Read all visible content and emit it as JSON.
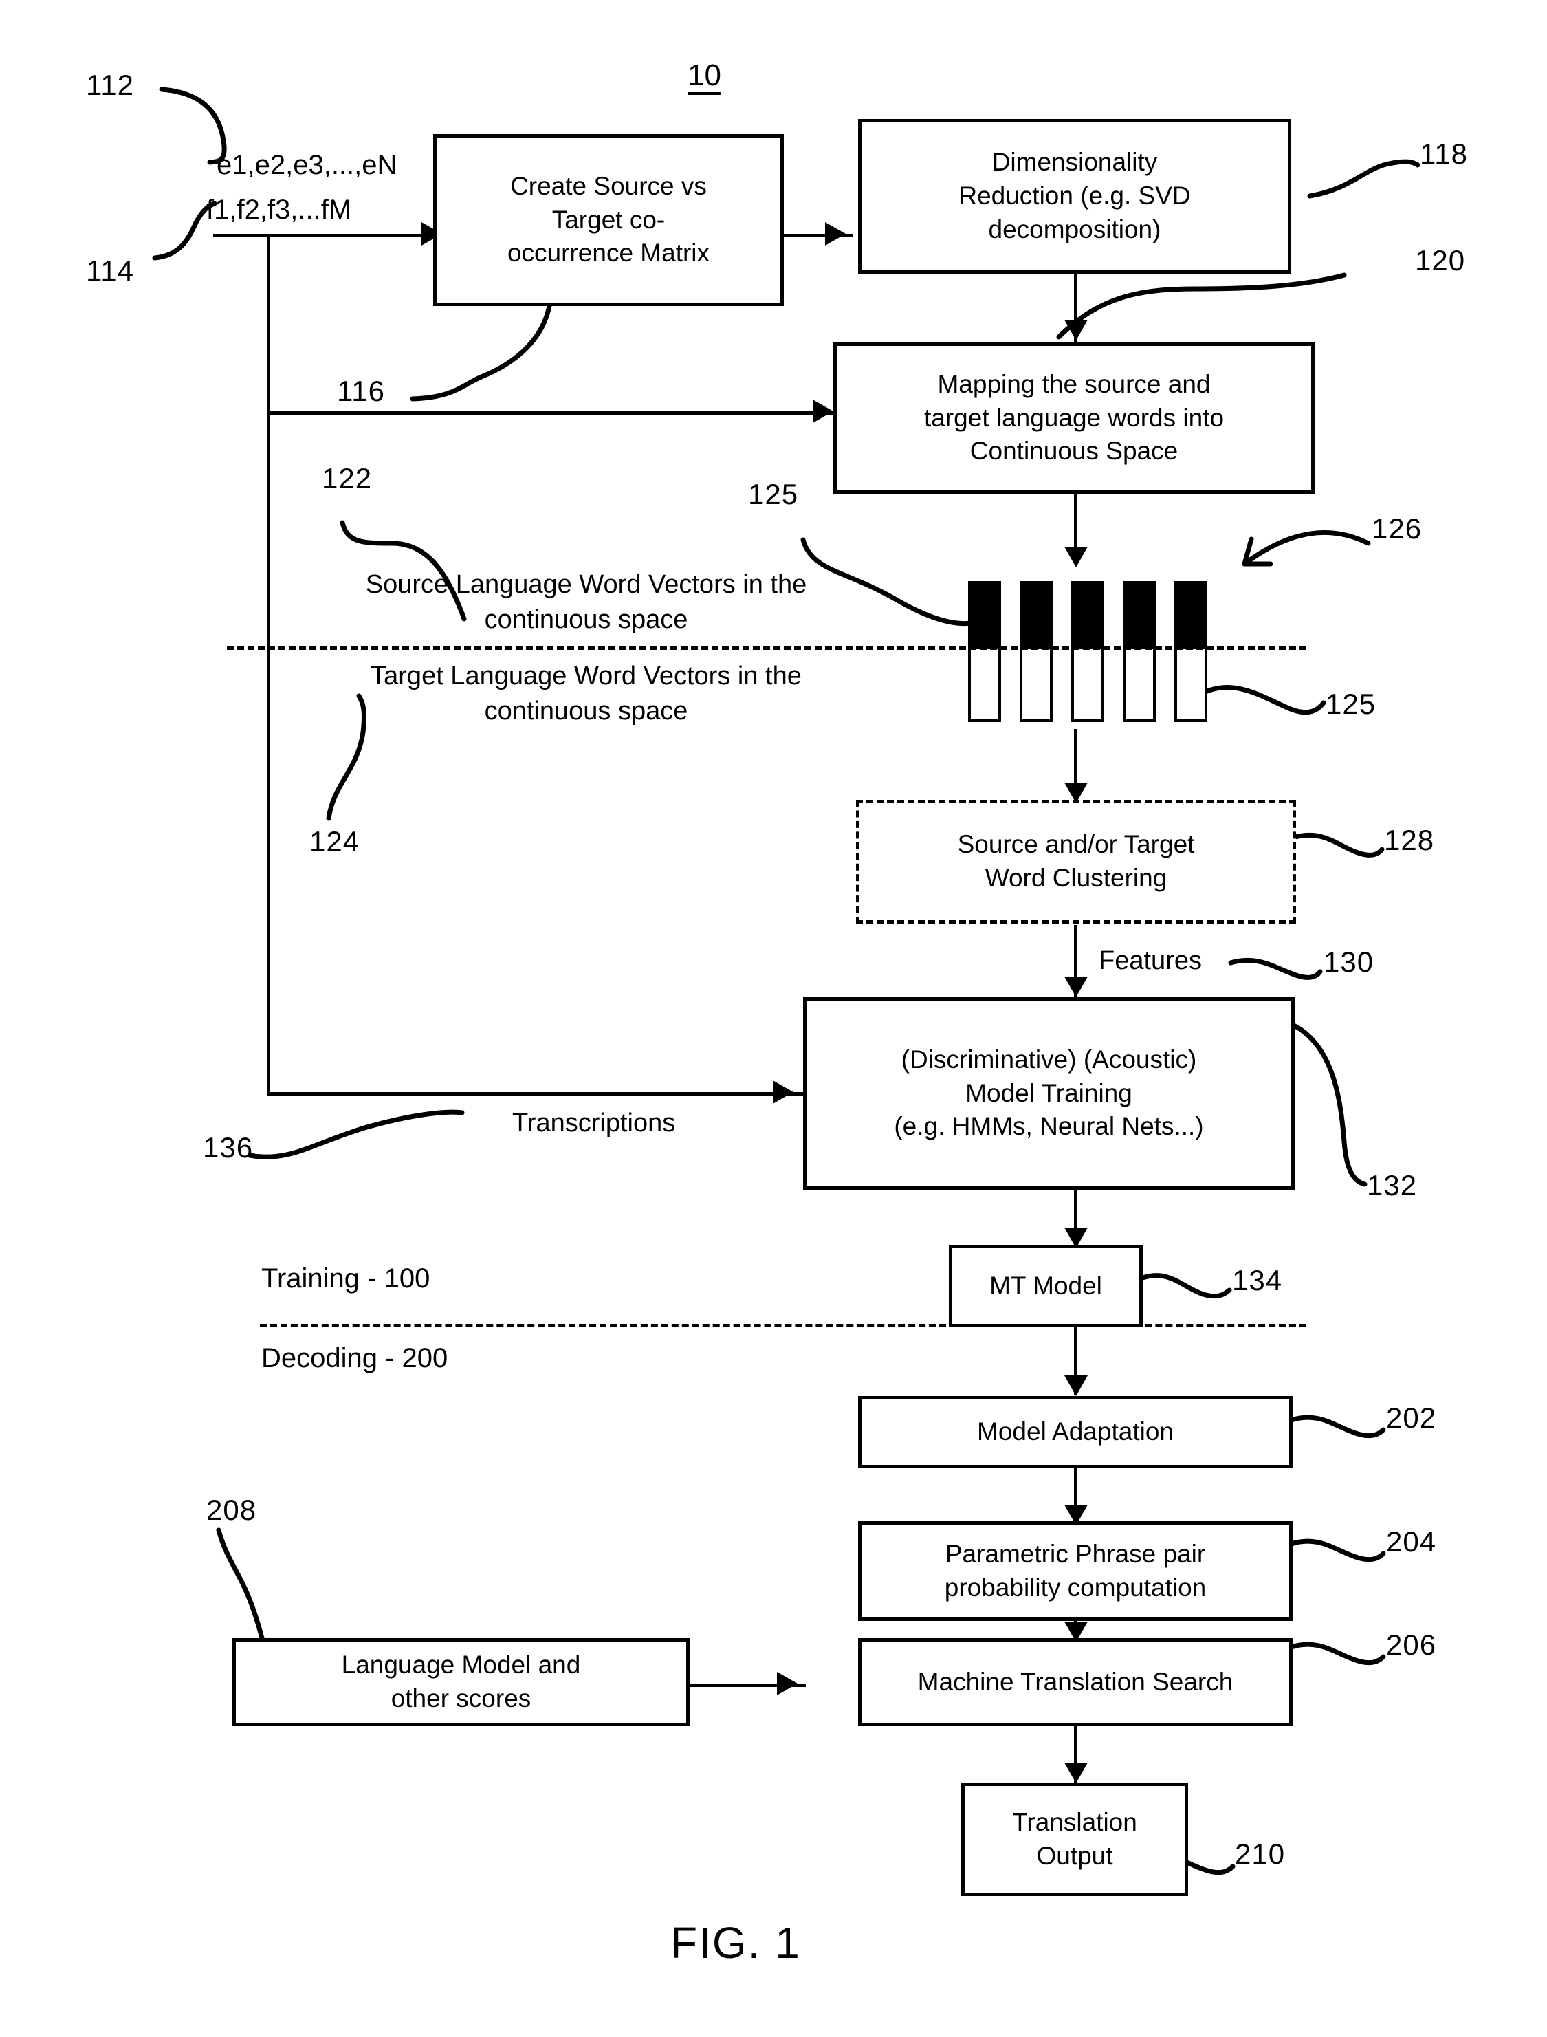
{
  "figure": {
    "caption": "FIG. 1",
    "system_ref": "10"
  },
  "inputs": {
    "source_words": "e1,e2,e3,...,eN",
    "target_words": "f1,f2,f3,...fM",
    "ref_source": "112",
    "ref_target": "114"
  },
  "boxes": [
    {
      "id": "cooccurrence",
      "label": "Create Source vs Target co-occurrence Matrix",
      "ref": "116",
      "style": "solid"
    },
    {
      "id": "dimensionality",
      "label": "Dimensionality Reduction (e.g. SVD decomposition)",
      "ref": "118",
      "style": "solid"
    },
    {
      "id": "mapping",
      "label": "Mapping the source and target language words into Continuous Space",
      "ref": "120",
      "style": "solid"
    },
    {
      "id": "clustering",
      "label": "Source and/or Target Word Clustering",
      "ref": "128",
      "style": "dashed"
    },
    {
      "id": "model-training",
      "label": "(Discriminative) (Acoustic) Model Training (e.g. HMMs, Neural Nets...)",
      "ref": "132",
      "style": "solid"
    },
    {
      "id": "mt-model",
      "label": "MT Model",
      "ref": "134",
      "style": "solid"
    },
    {
      "id": "model-adaptation",
      "label": "Model Adaptation",
      "ref": "202",
      "style": "solid"
    },
    {
      "id": "phrase-pair",
      "label": "Parametric Phrase pair probability computation",
      "ref": "204",
      "style": "solid"
    },
    {
      "id": "mt-search",
      "label": "Machine Translation Search",
      "ref": "206",
      "style": "solid"
    },
    {
      "id": "language-model",
      "label": "Language Model and other scores",
      "ref": "208",
      "style": "solid"
    },
    {
      "id": "translation-output",
      "label": "Translation Output",
      "ref": "210",
      "style": "solid"
    }
  ],
  "box_text": {
    "cooccurrence_l1": "Create Source vs",
    "cooccurrence_l2": "Target co-",
    "cooccurrence_l3": "occurrence Matrix",
    "dimensionality_l1": "Dimensionality",
    "dimensionality_l2": "Reduction (e.g. SVD",
    "dimensionality_l3": "decomposition)",
    "mapping_l1": "Mapping the source and",
    "mapping_l2": "target language words into",
    "mapping_l3": "Continuous Space",
    "clustering_l1": "Source and/or Target",
    "clustering_l2": "Word Clustering",
    "training_l1": "(Discriminative) (Acoustic)",
    "training_l2": "Model Training",
    "training_l3": "(e.g. HMMs, Neural Nets...)",
    "mt_model": "MT Model",
    "model_adaptation": "Model Adaptation",
    "phrase_pair_l1": "Parametric Phrase pair",
    "phrase_pair_l2": "probability computation",
    "mt_search": "Machine Translation Search",
    "language_model_l1": "Language Model and",
    "language_model_l2": "other scores",
    "translation_output_l1": "Translation",
    "translation_output_l2": "Output"
  },
  "annotations": {
    "source_vectors_l1": "Source Language Word Vectors in the",
    "source_vectors_l2": "continuous space",
    "source_vectors_ref": "122",
    "target_vectors_l1": "Target Language Word Vectors in the",
    "target_vectors_l2": "continuous space",
    "target_vectors_ref": "124",
    "vector_ref_top": "125",
    "vector_ref_bottom": "125",
    "vector_group_ref": "126",
    "features_label": "Features",
    "features_ref": "130",
    "transcriptions_label": "Transcriptions",
    "transcriptions_ref": "136",
    "phase_training": "Training - 100",
    "phase_decoding": "Decoding - 200"
  },
  "refs": {
    "r112": "112",
    "r114": "114",
    "r116": "116",
    "r118": "118",
    "r120": "120",
    "r122": "122",
    "r124": "124",
    "r125a": "125",
    "r125b": "125",
    "r126": "126",
    "r128": "128",
    "r130": "130",
    "r132": "132",
    "r134": "134",
    "r136": "136",
    "r202": "202",
    "r204": "204",
    "r206": "206",
    "r208": "208",
    "r210": "210"
  },
  "colors": {
    "ink": "#000000",
    "paper": "#ffffff"
  }
}
